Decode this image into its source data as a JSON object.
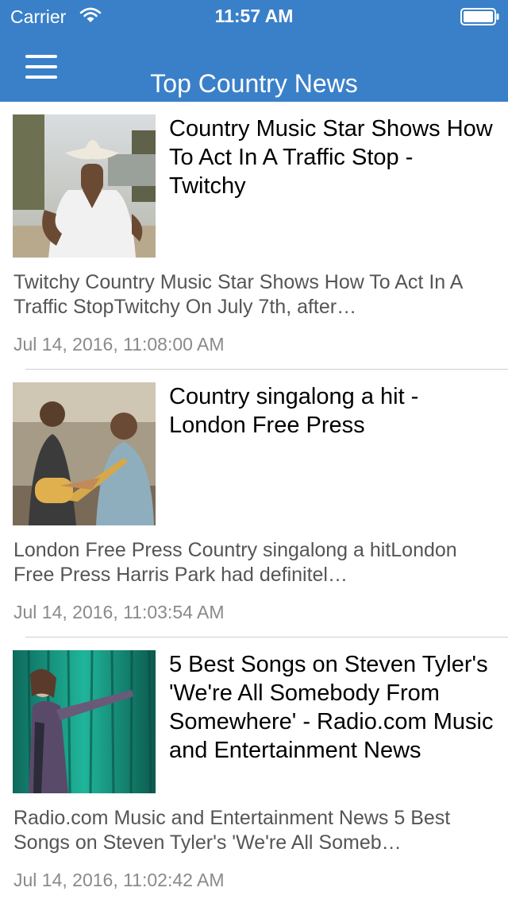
{
  "status_bar": {
    "carrier": "Carrier",
    "time": "11:57 AM"
  },
  "nav": {
    "title": "Top Country News",
    "menu_icon": "hamburger-menu-icon"
  },
  "colors": {
    "nav_background": "#3a80c8",
    "headline": "#000000",
    "summary": "#555555",
    "date": "#8a8a8a"
  },
  "articles": [
    {
      "title": "Country Music Star Shows How To Act In A Traffic Stop - Twitchy",
      "summary": "Twitchy    Country Music Star Shows How To Act In A Traffic StopTwitchy  On July 7th, after…",
      "date": "Jul 14, 2016, 11:08:00 AM"
    },
    {
      "title": "Country singalong a hit - London Free Press",
      "summary": "London Free Press    Country singalong a hitLondon Free Press  Harris Park had definitel…",
      "date": "Jul 14, 2016, 11:03:54 AM"
    },
    {
      "title": "5 Best Songs on Steven Tyler's 'We're All Somebody From Somewhere' - Radio.com Music and Entertainment News",
      "summary": "Radio.com Music and Entertainment News    5 Best Songs on Steven Tyler's 'We're All Someb…",
      "date": "Jul 14, 2016, 11:02:42 AM"
    }
  ]
}
